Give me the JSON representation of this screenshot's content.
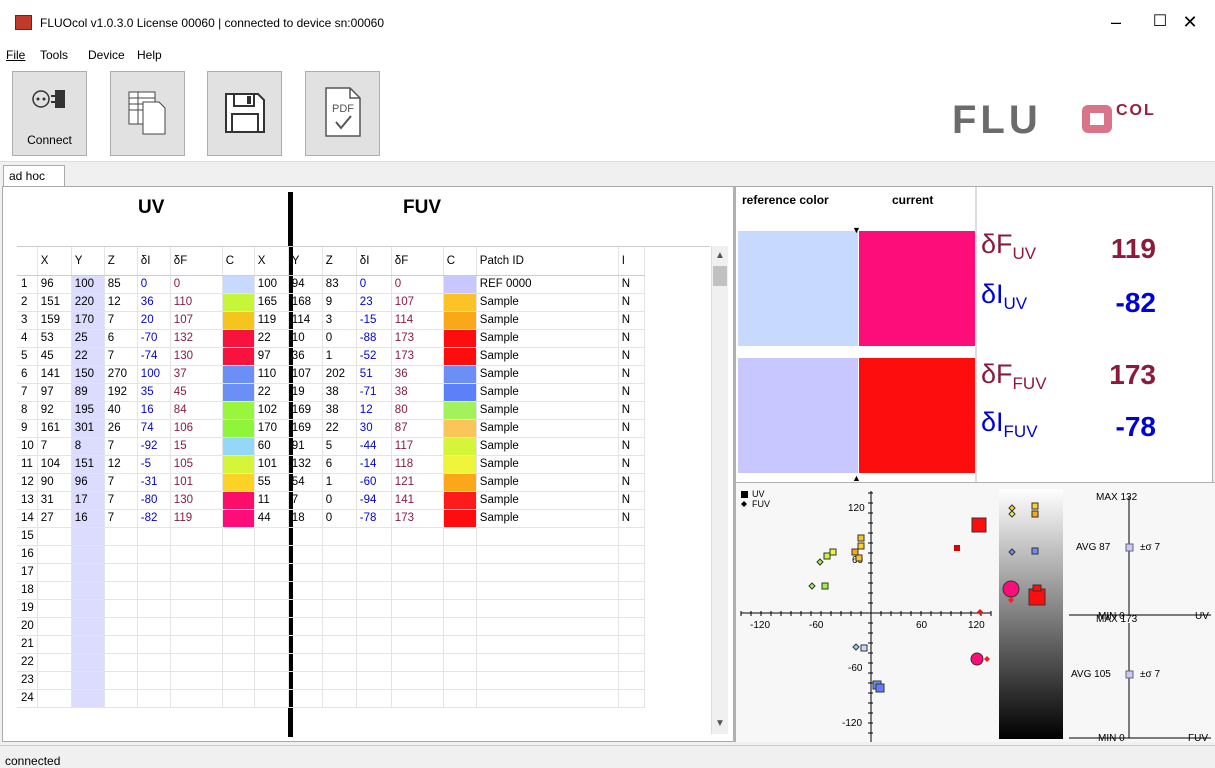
{
  "window": {
    "title": "FLUOcol v1.0.3.0 License 00060 | connected to device sn:00060",
    "minimize": "–",
    "maximize": "☐",
    "close": "✕"
  },
  "menu": [
    "File",
    "Tools",
    "Device",
    "Help"
  ],
  "toolbar": {
    "connect_label": "Connect",
    "buttons": [
      "plug-icon",
      "spreadsheet-icon",
      "save-icon",
      "pdf-icon"
    ],
    "pdf_text": "PDF"
  },
  "logo": {
    "main": "FLU",
    "small": "COL"
  },
  "tab": "ad hoc",
  "sections": {
    "uv": "UV",
    "fuv": "FUV"
  },
  "columns": [
    "X",
    "Y",
    "Z",
    "δI",
    "δF",
    "C",
    "X",
    "Y",
    "Z",
    "δI",
    "δF",
    "C",
    "Patch ID",
    "I"
  ],
  "rows": [
    {
      "n": "1",
      "uv": [
        "96",
        "100",
        "85",
        "0",
        "0"
      ],
      "uvc": "#c7d9ff",
      "fuv": [
        "100",
        "94",
        "83",
        "0",
        "0"
      ],
      "fuvc": "#c9c7ff",
      "id": "REF 0000",
      "i": "N"
    },
    {
      "n": "2",
      "uv": [
        "151",
        "220",
        "12",
        "36",
        "110"
      ],
      "uvc": "#c6f53a",
      "fuv": [
        "165",
        "168",
        "9",
        "23",
        "107"
      ],
      "fuvc": "#fcc327",
      "id": "Sample",
      "i": "N"
    },
    {
      "n": "3",
      "uv": [
        "159",
        "170",
        "7",
        "20",
        "107"
      ],
      "uvc": "#f5c51e",
      "fuv": [
        "119",
        "114",
        "3",
        "-15",
        "114"
      ],
      "fuvc": "#fba71a",
      "id": "Sample",
      "i": "N"
    },
    {
      "n": "4",
      "uv": [
        "53",
        "25",
        "6",
        "-70",
        "132"
      ],
      "uvc": "#f8123e",
      "fuv": [
        "22",
        "10",
        "0",
        "-88",
        "173"
      ],
      "fuvc": "#fd0d0d",
      "id": "Sample",
      "i": "N"
    },
    {
      "n": "5",
      "uv": [
        "45",
        "22",
        "7",
        "-74",
        "130"
      ],
      "uvc": "#f8123e",
      "fuv": [
        "97",
        "36",
        "1",
        "-52",
        "173"
      ],
      "fuvc": "#fd0d0d",
      "id": "Sample",
      "i": "N"
    },
    {
      "n": "6",
      "uv": [
        "141",
        "150",
        "270",
        "100",
        "37"
      ],
      "uvc": "#6b8ff5",
      "fuv": [
        "110",
        "107",
        "202",
        "51",
        "36"
      ],
      "fuvc": "#6b8ff5",
      "id": "Sample",
      "i": "N"
    },
    {
      "n": "7",
      "uv": [
        "97",
        "89",
        "192",
        "35",
        "45"
      ],
      "uvc": "#6b8ff5",
      "fuv": [
        "22",
        "19",
        "38",
        "-71",
        "38"
      ],
      "fuvc": "#5d7ff7",
      "id": "Sample",
      "i": "N"
    },
    {
      "n": "8",
      "uv": [
        "92",
        "195",
        "40",
        "16",
        "84"
      ],
      "uvc": "#9bf53d",
      "fuv": [
        "102",
        "169",
        "38",
        "12",
        "80"
      ],
      "fuvc": "#a3f25c",
      "id": "Sample",
      "i": "N"
    },
    {
      "n": "9",
      "uv": [
        "161",
        "301",
        "26",
        "74",
        "106"
      ],
      "uvc": "#8ff53a",
      "fuv": [
        "170",
        "169",
        "22",
        "30",
        "87"
      ],
      "fuvc": "#fbc55a",
      "id": "Sample",
      "i": "N"
    },
    {
      "n": "10",
      "uv": [
        "7",
        "8",
        "7",
        "-92",
        "15"
      ],
      "uvc": "#94d7f7",
      "fuv": [
        "60",
        "91",
        "5",
        "-44",
        "117"
      ],
      "fuvc": "#d5f53a",
      "id": "Sample",
      "i": "N"
    },
    {
      "n": "11",
      "uv": [
        "104",
        "151",
        "12",
        "-5",
        "105"
      ],
      "uvc": "#d5f53a",
      "fuv": [
        "101",
        "132",
        "6",
        "-14",
        "118"
      ],
      "fuvc": "#eef53a",
      "id": "Sample",
      "i": "N"
    },
    {
      "n": "12",
      "uv": [
        "90",
        "96",
        "7",
        "-31",
        "101"
      ],
      "uvc": "#fcd227",
      "fuv": [
        "55",
        "54",
        "1",
        "-60",
        "121"
      ],
      "fuvc": "#fba71a",
      "id": "Sample",
      "i": "N"
    },
    {
      "n": "13",
      "uv": [
        "31",
        "17",
        "7",
        "-80",
        "130"
      ],
      "uvc": "#fc0d6a",
      "fuv": [
        "11",
        "7",
        "0",
        "-94",
        "141"
      ],
      "fuvc": "#fd1b1b",
      "id": "Sample",
      "i": "N"
    },
    {
      "n": "14",
      "uv": [
        "27",
        "16",
        "7",
        "-82",
        "119"
      ],
      "uvc": "#fc0d7a",
      "fuv": [
        "44",
        "18",
        "0",
        "-78",
        "173"
      ],
      "fuvc": "#fd0d0d",
      "id": "Sample",
      "i": "N"
    },
    {
      "n": "15"
    },
    {
      "n": "16"
    },
    {
      "n": "17"
    },
    {
      "n": "18"
    },
    {
      "n": "19"
    },
    {
      "n": "20"
    },
    {
      "n": "21"
    },
    {
      "n": "22"
    },
    {
      "n": "23"
    },
    {
      "n": "24"
    }
  ],
  "compare": {
    "reference_label": "reference color",
    "current_label": "current",
    "uv_ref": "#c7d9ff",
    "uv_cur": "#fc0d7a",
    "fuv_ref": "#c9c7ff",
    "fuv_cur": "#fd0d0d",
    "dF_uv_sym": "δF",
    "dF_uv_sub": "UV",
    "dF_uv": "119",
    "dI_uv_sym": "δI",
    "dI_uv_sub": "UV",
    "dI_uv": "-82",
    "dF_fuv_sym": "δF",
    "dF_fuv_sub": "FUV",
    "dF_fuv": "173",
    "dI_fuv_sym": "δI",
    "dI_fuv_sub": "FUV",
    "dI_fuv": "-78"
  },
  "plot": {
    "legend_uv": "UV",
    "legend_fuv": "FUV",
    "x_ticks": [
      "-120",
      "-60",
      "60",
      "120"
    ],
    "y_ticks": [
      "120",
      "60",
      "-60",
      "-120"
    ],
    "uv_gauge": {
      "max": "MAX",
      "max_val": "132",
      "avg": "AVG 87",
      "sigma": "±σ 7",
      "min": "MIN",
      "min_val": "0",
      "label": "UV"
    },
    "fuv_gauge": {
      "max": "MAX",
      "max_val": "173",
      "avg": "AVG 105",
      "sigma": "±σ 7",
      "min": "MIN",
      "min_val": "0",
      "label": "FUV"
    }
  },
  "status": "connected"
}
